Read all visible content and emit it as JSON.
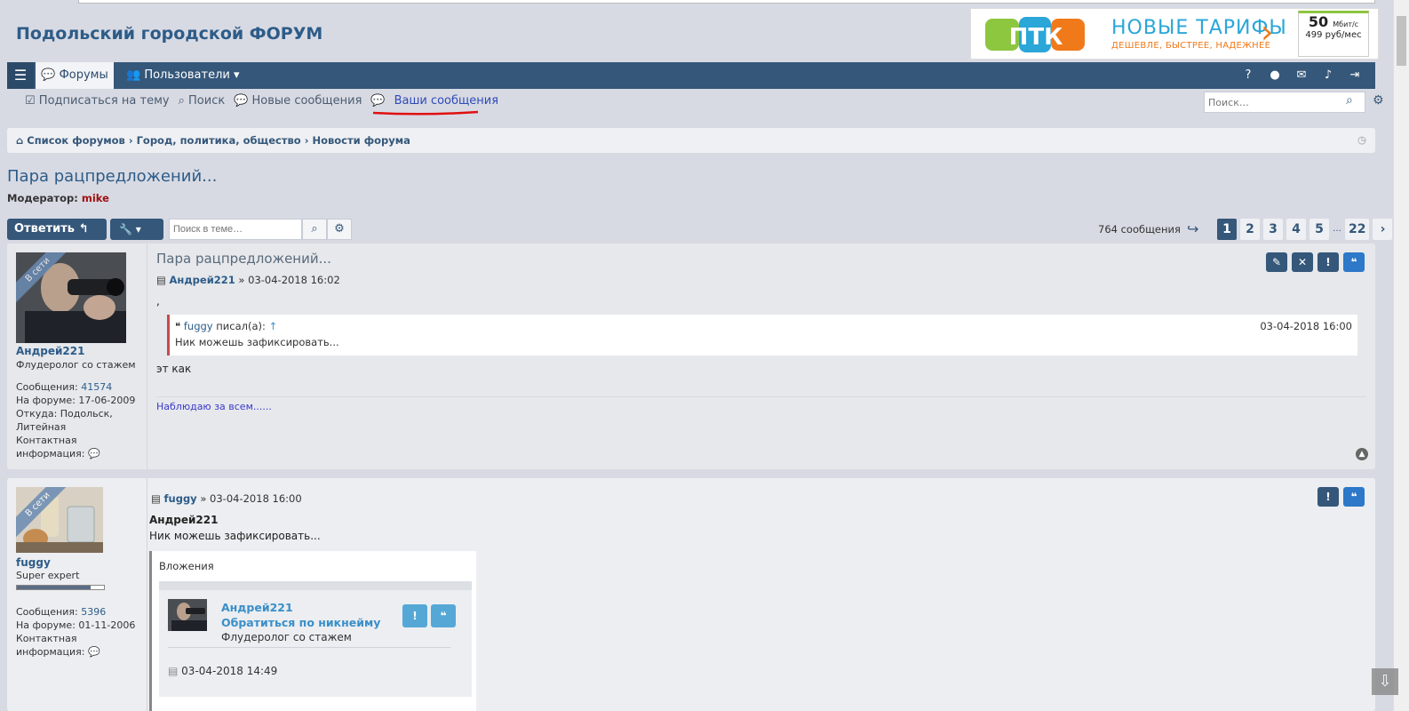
{
  "site": {
    "title": "Подольский городской ФОРУМ"
  },
  "banner": {
    "logo_text": "ПТК",
    "headline": "НОВЫЕ ТАРИФЫ",
    "tagline": "ДЕШЕВЛЕ, БЫСТРЕЕ, НАДЕЖНЕЕ",
    "speed": "50",
    "speed_unit": "Мбит/с",
    "price": "499 руб/мес"
  },
  "navbar": {
    "forums": "Форумы",
    "users": "Пользователи"
  },
  "subnav": {
    "subscribe": "Подписаться на тему",
    "search": "Поиск",
    "new_messages": "Новые сообщения",
    "your_messages": "Ваши сообщения"
  },
  "search": {
    "placeholder": "Поиск…"
  },
  "breadcrumbs": {
    "item1": "Список форумов",
    "item2": "Город, политика, общество",
    "item3": "Новости форума"
  },
  "topic": {
    "title": "Пара рацпредложений...",
    "moderator_label": "Модератор:",
    "moderator": "mike"
  },
  "toolbar": {
    "reply": "Ответить",
    "topic_search_placeholder": "Поиск в теме…",
    "count": "764 сообщения"
  },
  "pager": {
    "p1": "1",
    "p2": "2",
    "p3": "3",
    "p4": "4",
    "p5": "5",
    "dots": "…",
    "last": "22"
  },
  "post1": {
    "title": "Пара рацпредложений...",
    "author": "Андрей221",
    "date": "03-04-2018 16:02",
    "online": "В сети",
    "rank": "Флудеролог со стажем",
    "messages_label": "Сообщения:",
    "messages": "41574",
    "joined": "На форуме: 17-06-2009",
    "location1": "Откуда: Подольск,",
    "location2": "Литейная",
    "contact1": "Контактная",
    "contact2": "информация:",
    "comma": ",",
    "quote_author": "fuggy",
    "quote_wrote": "писал(а):",
    "quote_date": "03-04-2018 16:00",
    "quote_text": "Ник можешь зафиксировать...",
    "text": "эт как",
    "signature": "Наблюдаю за всем......"
  },
  "post2": {
    "author": "fuggy",
    "date": "03-04-2018 16:00",
    "online": "В сети",
    "rank": "Super expert",
    "progress": 0.85,
    "messages_label": "Сообщения:",
    "messages": "5396",
    "joined": "На форуме: 01-11-2006",
    "contact1": "Контактная",
    "contact2": "информация:",
    "addressee": "Андрей221",
    "text": "Ник можешь зафиксировать...",
    "attachments_label": "Вложения",
    "att_name": "Андрей221",
    "att_mention": "Обратиться по никнейму",
    "att_rank": "Флудеролог со стажем",
    "att_date": "03-04-2018 14:49"
  }
}
